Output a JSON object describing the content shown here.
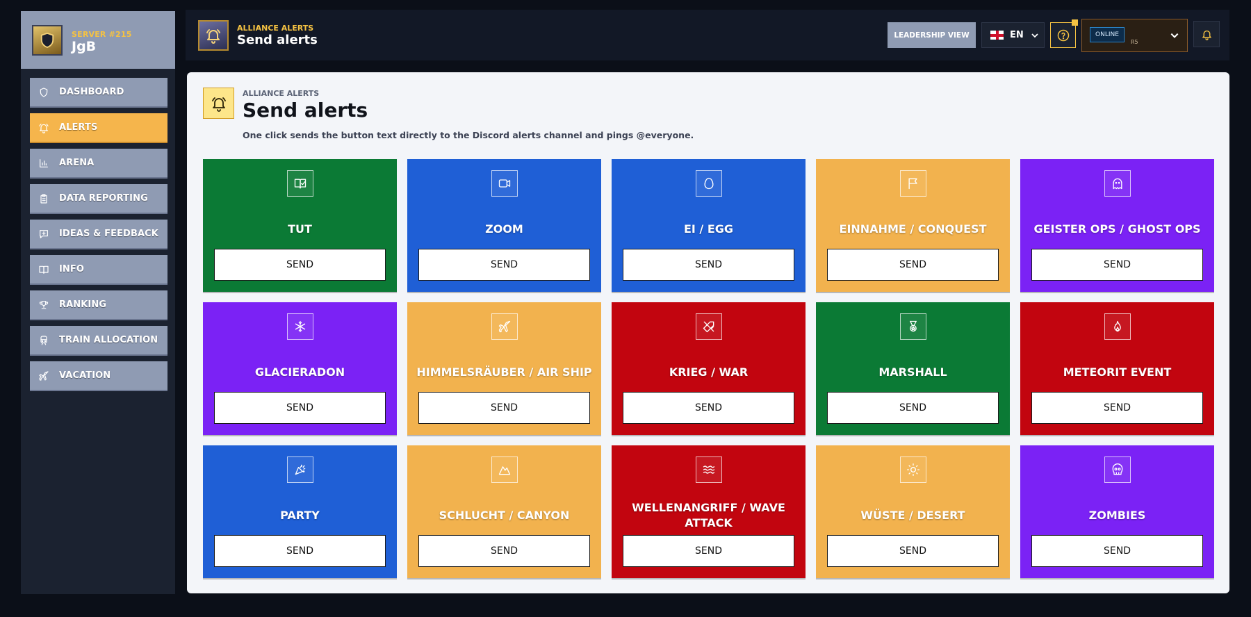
{
  "colors": {
    "green": "#0b7a35",
    "blue": "#1f5fd6",
    "orange": "#f2b24e",
    "purple": "#7b22f5",
    "red": "#c2050f",
    "accent": "#f5c242",
    "nav_active": "#f5b54c",
    "nav_idle": "#8f9bb3"
  },
  "sidebar": {
    "server_label": "SERVER #215",
    "server_name": "JgB",
    "items": [
      {
        "label": "DASHBOARD",
        "icon": "shield-icon",
        "active": false
      },
      {
        "label": "ALERTS",
        "icon": "bell-icon",
        "active": true
      },
      {
        "label": "ARENA",
        "icon": "bar-chart-icon",
        "active": false
      },
      {
        "label": "DATA REPORTING",
        "icon": "clipboard-icon",
        "active": false
      },
      {
        "label": "IDEAS & FEEDBACK",
        "icon": "message-plus-icon",
        "active": false
      },
      {
        "label": "INFO",
        "icon": "book-icon",
        "active": false
      },
      {
        "label": "RANKING",
        "icon": "trophy-icon",
        "active": false
      },
      {
        "label": "TRAIN ALLOCATION",
        "icon": "train-icon",
        "active": false
      },
      {
        "label": "VACATION",
        "icon": "plane-icon",
        "active": false
      }
    ]
  },
  "header": {
    "kicker": "ALLIANCE ALERTS",
    "title": "Send alerts",
    "leadership_label": "LEADERSHIP VIEW",
    "language": "EN",
    "status": "ONLINE",
    "rank": "R5"
  },
  "main": {
    "kicker": "ALLIANCE ALERTS",
    "title": "Send alerts",
    "description": "One click sends the button text directly to the Discord alerts channel and pings @everyone."
  },
  "alerts": [
    {
      "title": "TUT",
      "color": "green",
      "icon": "book-check-icon",
      "send_label": "SEND"
    },
    {
      "title": "ZOOM",
      "color": "blue",
      "icon": "video-icon",
      "send_label": "SEND"
    },
    {
      "title": "EI / EGG",
      "color": "blue",
      "icon": "egg-icon",
      "send_label": "SEND"
    },
    {
      "title": "EINNAHME / CONQUEST",
      "color": "orange",
      "icon": "flag-icon",
      "send_label": "SEND"
    },
    {
      "title": "GEISTER OPS / GHOST OPS",
      "color": "purple",
      "icon": "ghost-icon",
      "send_label": "SEND"
    },
    {
      "title": "GLACIERADON",
      "color": "purple",
      "icon": "snowflake-icon",
      "send_label": "SEND"
    },
    {
      "title": "HIMMELSRÄUBER / AIR SHIP",
      "color": "orange",
      "icon": "plane-icon",
      "send_label": "SEND"
    },
    {
      "title": "KRIEG / WAR",
      "color": "red",
      "icon": "swords-icon",
      "send_label": "SEND"
    },
    {
      "title": "MARSHALL",
      "color": "green",
      "icon": "medal-icon",
      "send_label": "SEND"
    },
    {
      "title": "METEORIT EVENT",
      "color": "red",
      "icon": "flame-icon",
      "send_label": "SEND"
    },
    {
      "title": "PARTY",
      "color": "blue",
      "icon": "party-popper-icon",
      "send_label": "SEND"
    },
    {
      "title": "SCHLUCHT / CANYON",
      "color": "orange",
      "icon": "mountain-icon",
      "send_label": "SEND"
    },
    {
      "title": "WELLENANGRIFF / WAVE ATTACK",
      "color": "red",
      "icon": "waves-icon",
      "send_label": "SEND"
    },
    {
      "title": "WÜSTE / DESERT",
      "color": "orange",
      "icon": "sun-icon",
      "send_label": "SEND"
    },
    {
      "title": "ZOMBIES",
      "color": "purple",
      "icon": "skull-icon",
      "send_label": "SEND"
    }
  ]
}
